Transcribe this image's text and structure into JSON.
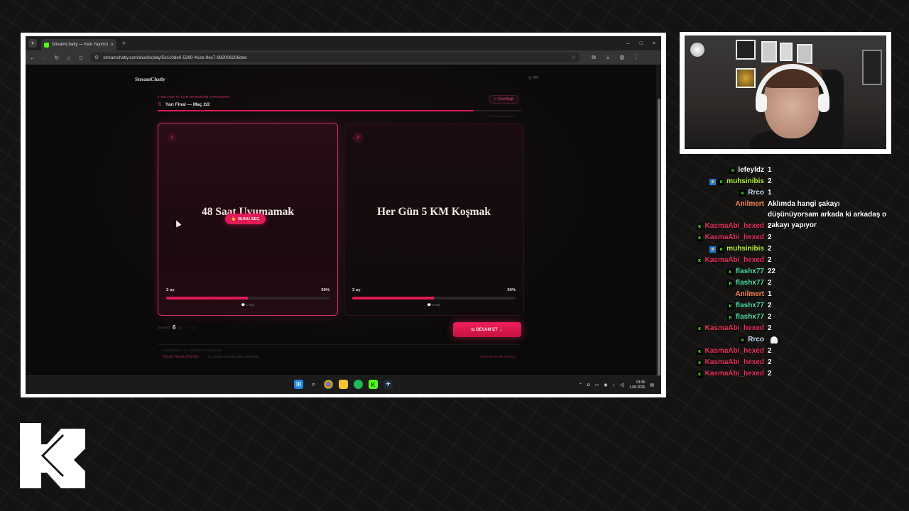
{
  "browser": {
    "tab_title": "StreamChatly — Kick Yayıncıla",
    "tab_close": "×",
    "new_tab": "+",
    "url": "streamchatly.com/duello/play/5e1c0de0-5290-41eb-9ec7-982006206dee",
    "window_controls": [
      "–",
      "□",
      "×"
    ]
  },
  "app": {
    "brand": "StreamChatly",
    "lang": "◎ TR",
    "question_title": "1 MİLYON TL İÇİN HANGİSİNİ YAPARDIN?",
    "round_icon": "⇅",
    "round_label": "Yarı Final — Maç 2/2",
    "chat_button": "⟐ Chat Bağlı",
    "progress_fraction": 0.87,
    "progress_note": "%70 oldu tamamlandı"
  },
  "cards": [
    {
      "number": "1",
      "text": "48 Saat Uyumamak",
      "choose_label": "BUNU SEÇ",
      "choose_icon": "👆",
      "votes_label": "3 oy",
      "percent_label": "50%",
      "percent": 50,
      "voters": "💬 1 seçi",
      "selected": true
    },
    {
      "number": "2",
      "text": "Her Gün 5 KM Koşmak",
      "votes_label": "3 oy",
      "percent_label": "50%",
      "percent": 50,
      "voters": "💬 2 seçi",
      "selected": false
    }
  ],
  "score": {
    "label": "Sonraki",
    "value": "6",
    "suffix": "oy",
    "hint": "1 · 1/2"
  },
  "continue_button": "⇆ DEVAM ET →",
  "history": {
    "title": "YARI FİNAL — İLK YARIŞMAT SONUÇLAR",
    "left": "Böcek Yemek (Pişmiş)",
    "mid": "2:1 · Ezme Gecinde Şarkı Söylemek",
    "right": "⊞ Böcek Yemek (Pişmiş)"
  },
  "taskbar": {
    "time": "03:36",
    "date": "1.08.2026"
  },
  "chat": [
    {
      "user": "lefeyldz",
      "color": "#ffffff",
      "badges": [
        "k"
      ],
      "text": "1"
    },
    {
      "user": "muhsinibis",
      "color": "#b7f53c",
      "badges": [
        "b",
        "k"
      ],
      "text": "2"
    },
    {
      "user": "Rrco",
      "color": "#c9e7ff",
      "badges": [
        "k"
      ],
      "text": "1"
    },
    {
      "user": "Anilmert",
      "color": "#ff8a55",
      "badges": [],
      "text": "Aklımda hangi şakayı düşünüyorsam arkada ki arkadaş o şakayı yapıyor",
      "multi": true
    },
    {
      "user": "KasmaAbi_hexed",
      "color": "#e8335c",
      "badges": [
        "k"
      ],
      "text": "2"
    },
    {
      "user": "KasmaAbi_hexed",
      "color": "#e8335c",
      "badges": [
        "k"
      ],
      "text": "2"
    },
    {
      "user": "muhsinibis",
      "color": "#b7f53c",
      "badges": [
        "b",
        "k"
      ],
      "text": "2"
    },
    {
      "user": "KasmaAbi_hexed",
      "color": "#e8335c",
      "badges": [
        "k"
      ],
      "text": "2"
    },
    {
      "user": "flashx77",
      "color": "#4fe0a8",
      "badges": [
        "k"
      ],
      "text": "22"
    },
    {
      "user": "flashx77",
      "color": "#4fe0a8",
      "badges": [
        "k"
      ],
      "text": "2"
    },
    {
      "user": "Anilmert",
      "color": "#ff8a55",
      "badges": [],
      "text": "1"
    },
    {
      "user": "flashx77",
      "color": "#4fe0a8",
      "badges": [
        "k"
      ],
      "text": "2"
    },
    {
      "user": "flashx77",
      "color": "#4fe0a8",
      "badges": [
        "k"
      ],
      "text": "2"
    },
    {
      "user": "KasmaAbi_hexed",
      "color": "#e8335c",
      "badges": [
        "k"
      ],
      "text": "2"
    },
    {
      "user": "Rrco",
      "color": "#c9e7ff",
      "badges": [
        "k"
      ],
      "text": "",
      "ghost": true
    },
    {
      "user": "KasmaAbi_hexed",
      "color": "#e8335c",
      "badges": [
        "k"
      ],
      "text": "2"
    },
    {
      "user": "KasmaAbi_hexed",
      "color": "#e8335c",
      "badges": [
        "k"
      ],
      "text": "2"
    },
    {
      "user": "KasmaAbi_hexed",
      "color": "#e8335c",
      "badges": [
        "k"
      ],
      "text": "2"
    }
  ]
}
